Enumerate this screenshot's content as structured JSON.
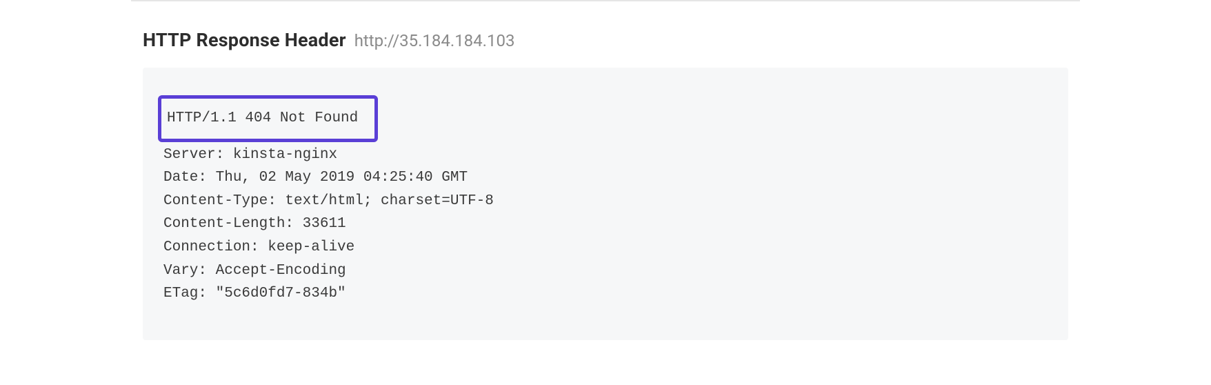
{
  "section": {
    "title": "HTTP Response Header",
    "url": "http://35.184.184.103"
  },
  "headers": {
    "status_line": "HTTP/1.1 404 Not Found",
    "lines": [
      "Server: kinsta-nginx",
      "Date: Thu, 02 May 2019 04:25:40 GMT",
      "Content-Type: text/html; charset=UTF-8",
      "Content-Length: 33611",
      "Connection: keep-alive",
      "Vary: Accept-Encoding",
      "ETag: \"5c6d0fd7-834b\""
    ]
  }
}
